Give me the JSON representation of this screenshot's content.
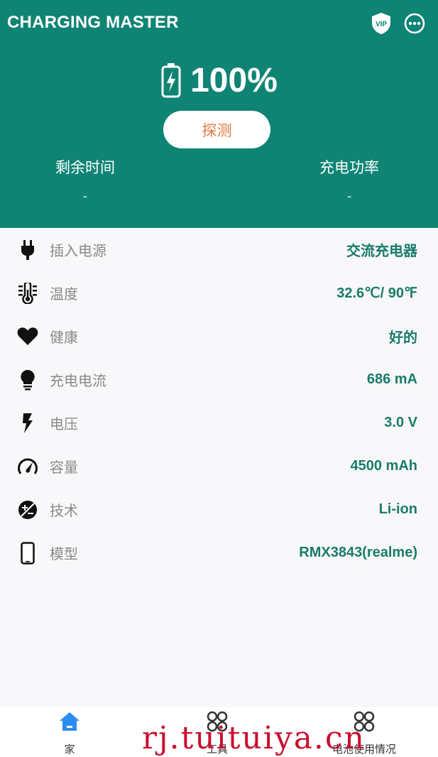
{
  "app": {
    "title": "CHARGING MASTER"
  },
  "header": {
    "vip_text": "VIP",
    "battery_percent": "100%",
    "detect_button": "探测",
    "remaining_time": {
      "label": "剩余时间",
      "value": "-"
    },
    "charge_power": {
      "label": "充电功率",
      "value": "-"
    }
  },
  "details": [
    {
      "icon": "plug-icon",
      "label": "插入电源",
      "value": "交流充电器"
    },
    {
      "icon": "thermometer-icon",
      "label": "温度",
      "value": "32.6℃/ 90℉"
    },
    {
      "icon": "heart-icon",
      "label": "健康",
      "value": "好的"
    },
    {
      "icon": "bulb-icon",
      "label": "充电电流",
      "value": "686 mA"
    },
    {
      "icon": "bolt-icon",
      "label": "电压",
      "value": "3.0 V"
    },
    {
      "icon": "gauge-icon",
      "label": "容量",
      "value": "4500 mAh"
    },
    {
      "icon": "plus-minus-icon",
      "label": "技术",
      "value": "Li-ion"
    },
    {
      "icon": "phone-icon",
      "label": "模型",
      "value": "RMX3843(realme)"
    }
  ],
  "nav": {
    "home": "家",
    "tools": "工具",
    "usage": "电池使用情况"
  },
  "watermark": "rj.tuituiya.cn",
  "colors": {
    "header_bg": "#0f8474",
    "accent_value": "#1a7c6a",
    "detect_text": "#e07a43",
    "home_active": "#2a8df0"
  }
}
